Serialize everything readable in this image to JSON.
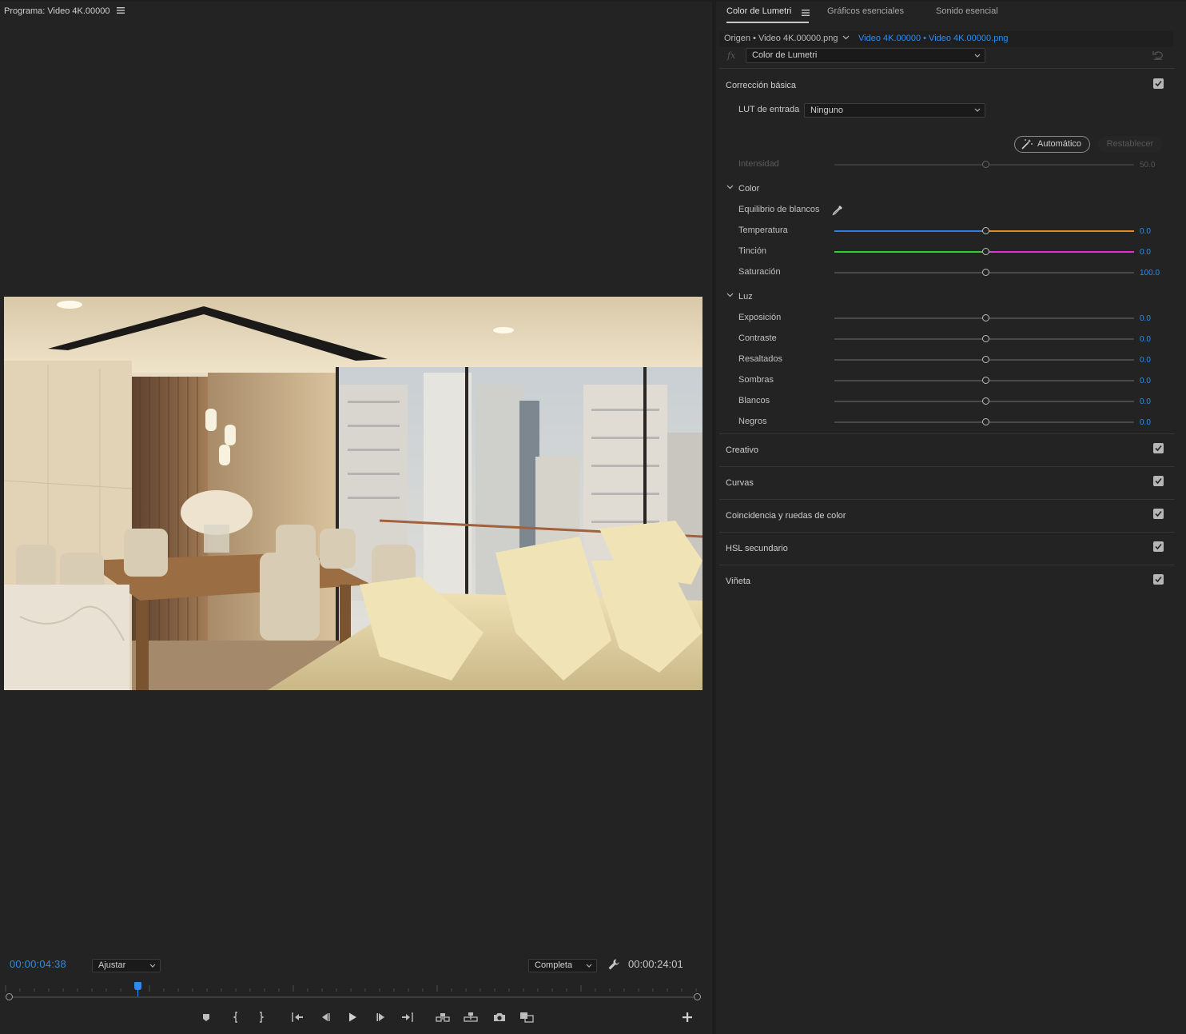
{
  "program_monitor": {
    "title": "Programa: Video 4K.00000",
    "menu_icon": "hamburger-menu-icon",
    "current_timecode": "00:00:04:38",
    "total_timecode": "00:00:24:01",
    "zoom_value": "Ajustar",
    "quality_value": "Completa",
    "playhead_fraction": 0.19,
    "transport_icons": [
      "marker-icon",
      "mark-in-icon",
      "mark-out-icon",
      "go-to-in-icon",
      "step-back-icon",
      "play-icon",
      "step-forward-icon",
      "go-to-out-icon",
      "insert-icon",
      "overwrite-icon",
      "export-frame-icon",
      "comparison-view-icon",
      "add-button-icon"
    ]
  },
  "panel": {
    "tabs": [
      {
        "label": "Color de Lumetri"
      },
      {
        "label": "Gráficos esenciales"
      },
      {
        "label": "Sonido esencial"
      }
    ],
    "source_origin": "Origen • Video 4K.00000.png",
    "source_clip": "Video 4K.00000 • Video 4K.00000.png",
    "fx_label": "fx",
    "effect_value": "Color de Lumetri",
    "basic": {
      "title": "Corrección básica",
      "lut_label": "LUT de entrada",
      "lut_value": "Ninguno",
      "auto_label": "Automático",
      "restore_label": "Restablecer",
      "intensity_label": "Intensidad",
      "intensity_value": "50.0",
      "color_group": "Color",
      "white_balance_label": "Equilibrio de blancos",
      "temperature_label": "Temperatura",
      "temperature_value": "0.0",
      "tint_label": "Tinción",
      "tint_value": "0.0",
      "saturation_label": "Saturación",
      "saturation_value": "100.0",
      "light_group": "Luz",
      "exposure_label": "Exposición",
      "exposure_value": "0.0",
      "contrast_label": "Contraste",
      "contrast_value": "0.0",
      "highlights_label": "Resaltados",
      "highlights_value": "0.0",
      "shadows_label": "Sombras",
      "shadows_value": "0.0",
      "whites_label": "Blancos",
      "whites_value": "0.0",
      "blacks_label": "Negros",
      "blacks_value": "0.0"
    },
    "sections": [
      {
        "label": "Creativo"
      },
      {
        "label": "Curvas"
      },
      {
        "label": "Coincidencia y ruedas de color"
      },
      {
        "label": "HSL secundario"
      },
      {
        "label": "Viñeta"
      }
    ]
  },
  "colors": {
    "accent": "#2d8ceb",
    "temperature_left": "#2f7de0",
    "temperature_right": "#e08a2a",
    "tint_left": "#2fd12f",
    "tint_right": "#e02fd0"
  }
}
